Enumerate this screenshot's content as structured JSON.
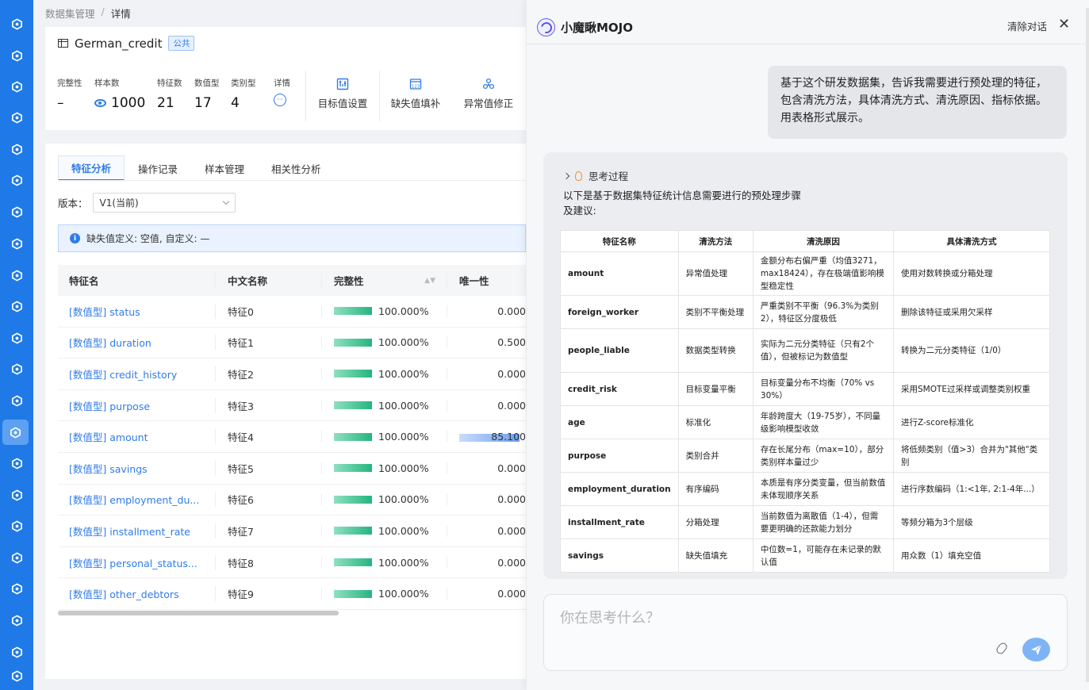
{
  "breadcrumb": {
    "parent": "数据集管理",
    "separator": "/",
    "current": "详情"
  },
  "dataset": {
    "name": "German_credit",
    "badge": "公共",
    "stats": [
      {
        "label": "完整性",
        "value": "–"
      },
      {
        "label": "样本数",
        "value": "1000"
      },
      {
        "label": "特征数",
        "value": "21"
      },
      {
        "label": "数值型",
        "value": "17"
      },
      {
        "label": "类别型",
        "value": "4"
      },
      {
        "label": "详情",
        "value": "···"
      }
    ],
    "actions": [
      {
        "label": "目标值设置",
        "icon": "target-setting-icon"
      },
      {
        "label": "缺失值填补",
        "icon": "missing-fill-icon"
      },
      {
        "label": "异常值修正",
        "icon": "outlier-fix-icon"
      }
    ]
  },
  "tabs": [
    "特征分析",
    "操作记录",
    "样本管理",
    "相关性分析"
  ],
  "version": {
    "label": "版本：",
    "value": "V1(当前)"
  },
  "alert": "缺失值定义: 空值, 自定义: —",
  "feature_table": {
    "headers": [
      "特征名",
      "中文名称",
      "完整性",
      "唯一性"
    ],
    "rows": [
      {
        "type": "[数值型]",
        "name": "status",
        "cn": "特征0",
        "completeness": "100.000%",
        "uniqueness": "0.000"
      },
      {
        "type": "[数值型]",
        "name": "duration",
        "cn": "特征1",
        "completeness": "100.000%",
        "uniqueness": "0.500"
      },
      {
        "type": "[数值型]",
        "name": "credit_history",
        "cn": "特征2",
        "completeness": "100.000%",
        "uniqueness": "0.000"
      },
      {
        "type": "[数值型]",
        "name": "purpose",
        "cn": "特征3",
        "completeness": "100.000%",
        "uniqueness": "0.000"
      },
      {
        "type": "[数值型]",
        "name": "amount",
        "cn": "特征4",
        "completeness": "100.000%",
        "uniqueness": "85.100"
      },
      {
        "type": "[数值型]",
        "name": "savings",
        "cn": "特征5",
        "completeness": "100.000%",
        "uniqueness": "0.000"
      },
      {
        "type": "[数值型]",
        "name": "employment_du...",
        "cn": "特征6",
        "completeness": "100.000%",
        "uniqueness": "0.000"
      },
      {
        "type": "[数值型]",
        "name": "installment_rate",
        "cn": "特征7",
        "completeness": "100.000%",
        "uniqueness": "0.000"
      },
      {
        "type": "[数值型]",
        "name": "personal_status...",
        "cn": "特征8",
        "completeness": "100.000%",
        "uniqueness": "0.000"
      },
      {
        "type": "[数值型]",
        "name": "other_debtors",
        "cn": "特征9",
        "completeness": "100.000%",
        "uniqueness": "0.000"
      }
    ]
  },
  "chat": {
    "title": "小魔瞅MOJO",
    "clear": "清除对话",
    "close": "✕",
    "user_message": "基于这个研发数据集，告诉我需要进行预处理的特征，包含清洗方法，具体清洗方式、清洗原因、指标依据。用表格形式展示。",
    "thinking_label": "思考过程",
    "bot_intro": "以下是基于数据集特征统计信息需要进行的预处理步骤及建议:",
    "table_headers": [
      "特征名称",
      "清洗方法",
      "清洗原因",
      "具体清洗方式"
    ],
    "table_rows": [
      [
        "amount",
        "异常值处理",
        "金额分布右偏严重（均值3271，max18424），存在极端值影响模型稳定性",
        "使用对数转换或分箱处理"
      ],
      [
        "foreign_worker",
        "类别不平衡处理",
        "严重类别不平衡（96.3%为类别2），特征区分度极低",
        "删除该特征或采用欠采样"
      ],
      [
        "people_liable",
        "数据类型转换",
        "实际为二元分类特征（只有2个值），但被标记为数值型",
        "转换为二元分类特征（1/0）"
      ],
      [
        "credit_risk",
        "目标变量平衡",
        "目标变量分布不均衡（70% vs 30%）",
        "采用SMOTE过采样或调整类别权重"
      ],
      [
        "age",
        "标准化",
        "年龄跨度大（19-75岁），不同量级影响模型收敛",
        "进行Z-score标准化"
      ],
      [
        "purpose",
        "类别合并",
        "存在长尾分布（max=10），部分类别样本量过少",
        "将低频类别（值>3）合并为\"其他\"类别"
      ],
      [
        "employment_duration",
        "有序编码",
        "本质是有序分类变量，但当前数值未体现顺序关系",
        "进行序数编码（1:<1年, 2:1-4年...）"
      ],
      [
        "installment_rate",
        "分箱处理",
        "当前数值为离散值（1-4），但需要更明确的还款能力划分",
        "等频分箱为3个层级"
      ],
      [
        "savings",
        "缺失值填充",
        "中位数=1，可能存在未记录的默认值",
        "用众数（1）填充空值"
      ]
    ],
    "input_placeholder": "你在思考什么？"
  },
  "colors": {
    "accent": "#2f7ce8",
    "rail": "#1f7ae8",
    "bar_green": "#24b57e",
    "bar_blue": "#6a9ff0"
  }
}
